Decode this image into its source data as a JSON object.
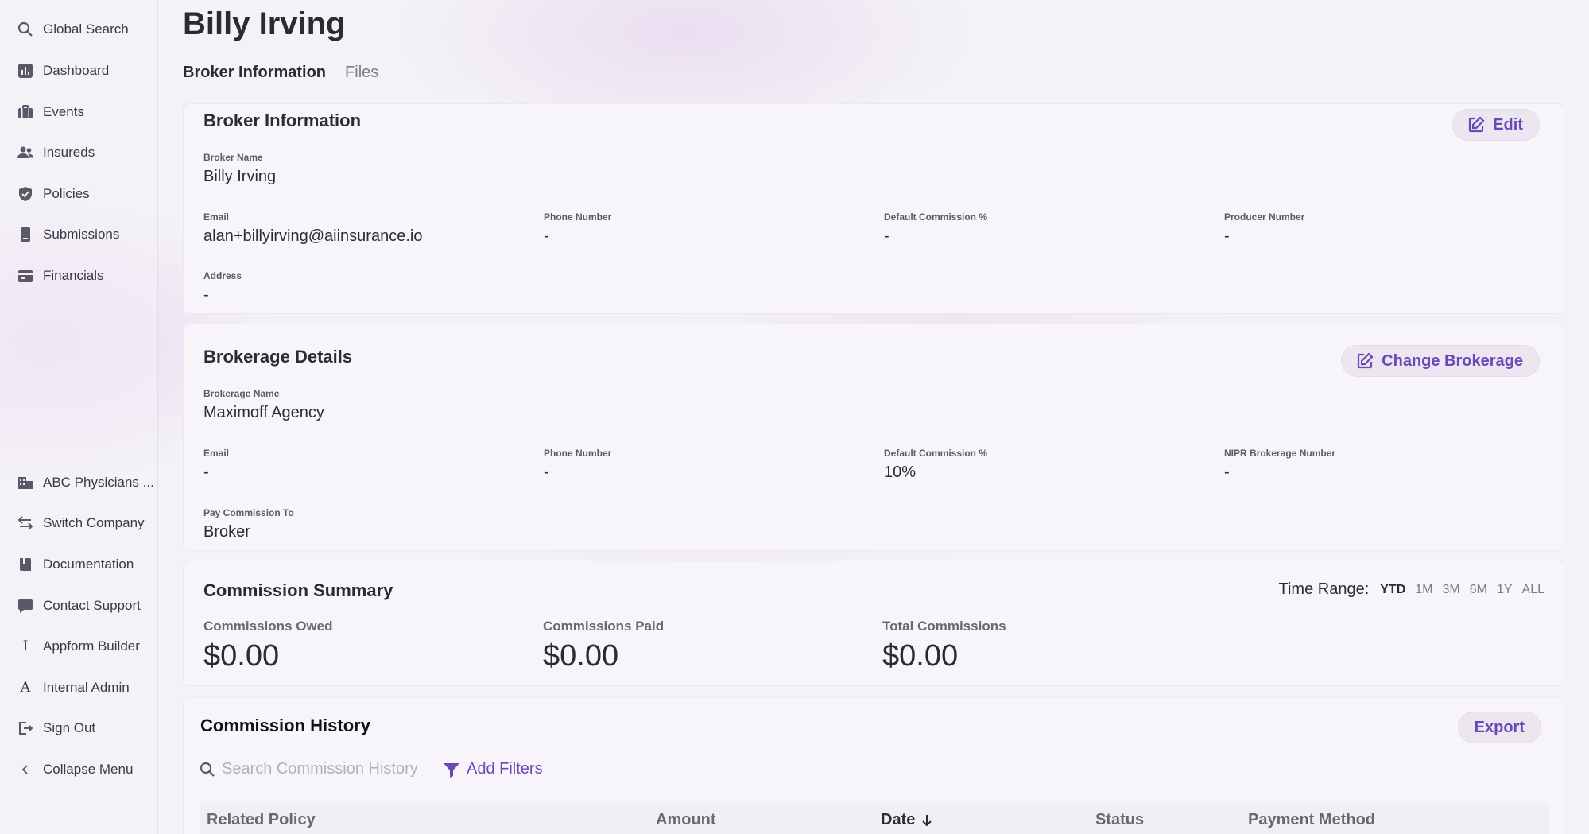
{
  "sidebar": {
    "top_items": [
      {
        "label": "Global Search",
        "icon": "search-icon"
      },
      {
        "label": "Dashboard",
        "icon": "chart-icon"
      },
      {
        "label": "Events",
        "icon": "briefcase-icon"
      },
      {
        "label": "Insureds",
        "icon": "users-icon"
      },
      {
        "label": "Policies",
        "icon": "shield-icon"
      },
      {
        "label": "Submissions",
        "icon": "document-icon"
      },
      {
        "label": "Financials",
        "icon": "card-icon"
      }
    ],
    "bottom_items": [
      {
        "label": "ABC Physicians ...",
        "icon": "building-icon"
      },
      {
        "label": "Switch Company",
        "icon": "switch-icon"
      },
      {
        "label": "Documentation",
        "icon": "book-icon"
      },
      {
        "label": "Contact Support",
        "icon": "chat-icon"
      },
      {
        "label": "Appform Builder",
        "icon": "letter-i-icon"
      },
      {
        "label": "Internal Admin",
        "icon": "letter-a-icon"
      },
      {
        "label": "Sign Out",
        "icon": "sign-out-icon"
      },
      {
        "label": "Collapse Menu",
        "icon": "chevron-left-icon"
      }
    ]
  },
  "page": {
    "title": "Billy Irving",
    "tabs": [
      "Broker Information",
      "Files"
    ]
  },
  "broker_info": {
    "title": "Broker Information",
    "edit_label": "Edit",
    "broker_name_label": "Broker Name",
    "broker_name": "Billy Irving",
    "email_label": "Email",
    "email": "alan+billyirving@aiinsurance.io",
    "phone_label": "Phone Number",
    "phone": "-",
    "commission_label": "Default Commission %",
    "commission": "-",
    "producer_label": "Producer Number",
    "producer": "-",
    "address_label": "Address",
    "address": "-"
  },
  "brokerage": {
    "title": "Brokerage Details",
    "change_label": "Change Brokerage",
    "name_label": "Brokerage Name",
    "name": "Maximoff Agency",
    "email_label": "Email",
    "email": "-",
    "phone_label": "Phone Number",
    "phone": "-",
    "commission_label": "Default Commission %",
    "commission": "10%",
    "nipr_label": "NIPR Brokerage Number",
    "nipr": "-",
    "pay_label": "Pay Commission To",
    "pay": "Broker"
  },
  "summary": {
    "title": "Commission Summary",
    "range_label": "Time Range:",
    "range_options": [
      "YTD",
      "1M",
      "3M",
      "6M",
      "1Y",
      "ALL"
    ],
    "range_selected": "YTD",
    "owed_label": "Commissions Owed",
    "owed": "$0.00",
    "paid_label": "Commissions Paid",
    "paid": "$0.00",
    "total_label": "Total Commissions",
    "total": "$0.00"
  },
  "history": {
    "title": "Commission History",
    "export_label": "Export",
    "search_placeholder": "Search Commission History",
    "filters_label": "Add Filters",
    "columns": [
      "Related Policy",
      "Amount",
      "Date",
      "Status",
      "Payment Method"
    ],
    "sorted_column": "Date"
  },
  "colors": {
    "accent": "#6b48b8",
    "text": "#2c2a33",
    "background": "#f4f2f6"
  }
}
